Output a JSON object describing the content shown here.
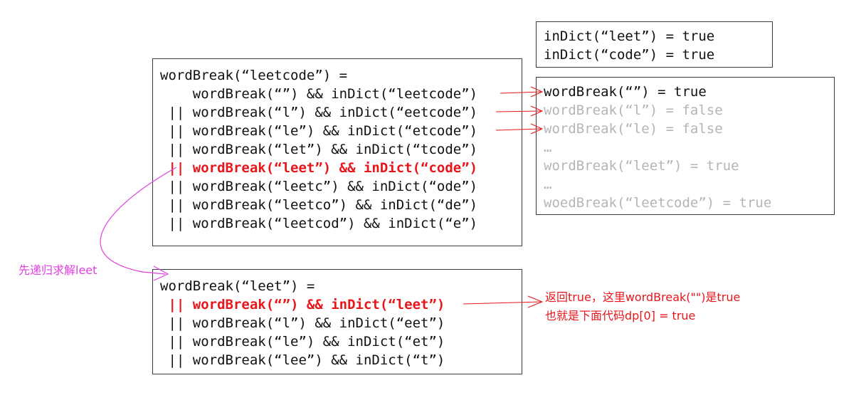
{
  "dict_box": {
    "lines": [
      "inDict(“leet”) = true",
      "inDict(“code”) = true"
    ]
  },
  "main_box": {
    "header": "wordBreak(“leetcode”) =",
    "lines": [
      "    wordBreak(“”) && inDict(“leetcode”)",
      " || wordBreak(“l”) && inDict(“eetcode”)",
      " || wordBreak(“le”) && inDict(“etcode”)",
      " || wordBreak(“let”) && inDict(“tcode”)",
      " || wordBreak(“leet”) && inDict(“code”)",
      " || wordBreak(“leetc”) && inDict(“ode”)",
      " || wordBreak(“leetco”) && inDict(“de”)",
      " || wordBreak(“leetcod”) && inDict(“e”)"
    ]
  },
  "results_box": {
    "lines": [
      "wordBreak(“”) = true",
      "wordBreak(“l”) = false",
      "wordBreak(“le) = false",
      "…",
      "wordBreak(“leet”) = true",
      "…",
      "woedBreak(“leetcode”) = true"
    ]
  },
  "leet_box": {
    "header": "wordBreak(“leet”) =",
    "lines": [
      " || wordBreak(“”) && inDict(“leet”)",
      " || wordBreak(“l”) && inDict(“eet”)",
      " || wordBreak(“le”) && inDict(“et”)",
      " || wordBreak(“lee”) && inDict(“t”)"
    ]
  },
  "annotations": {
    "recurse_label": "先递归求解leet",
    "return_note_line1": "返回true，这里wordBreak(\"\")是true",
    "return_note_line2": "也就是下面代码dp[0] = true"
  },
  "colors": {
    "highlight": "#e8161b",
    "muted": "#b5b5b5",
    "curve": "#e040e0"
  }
}
